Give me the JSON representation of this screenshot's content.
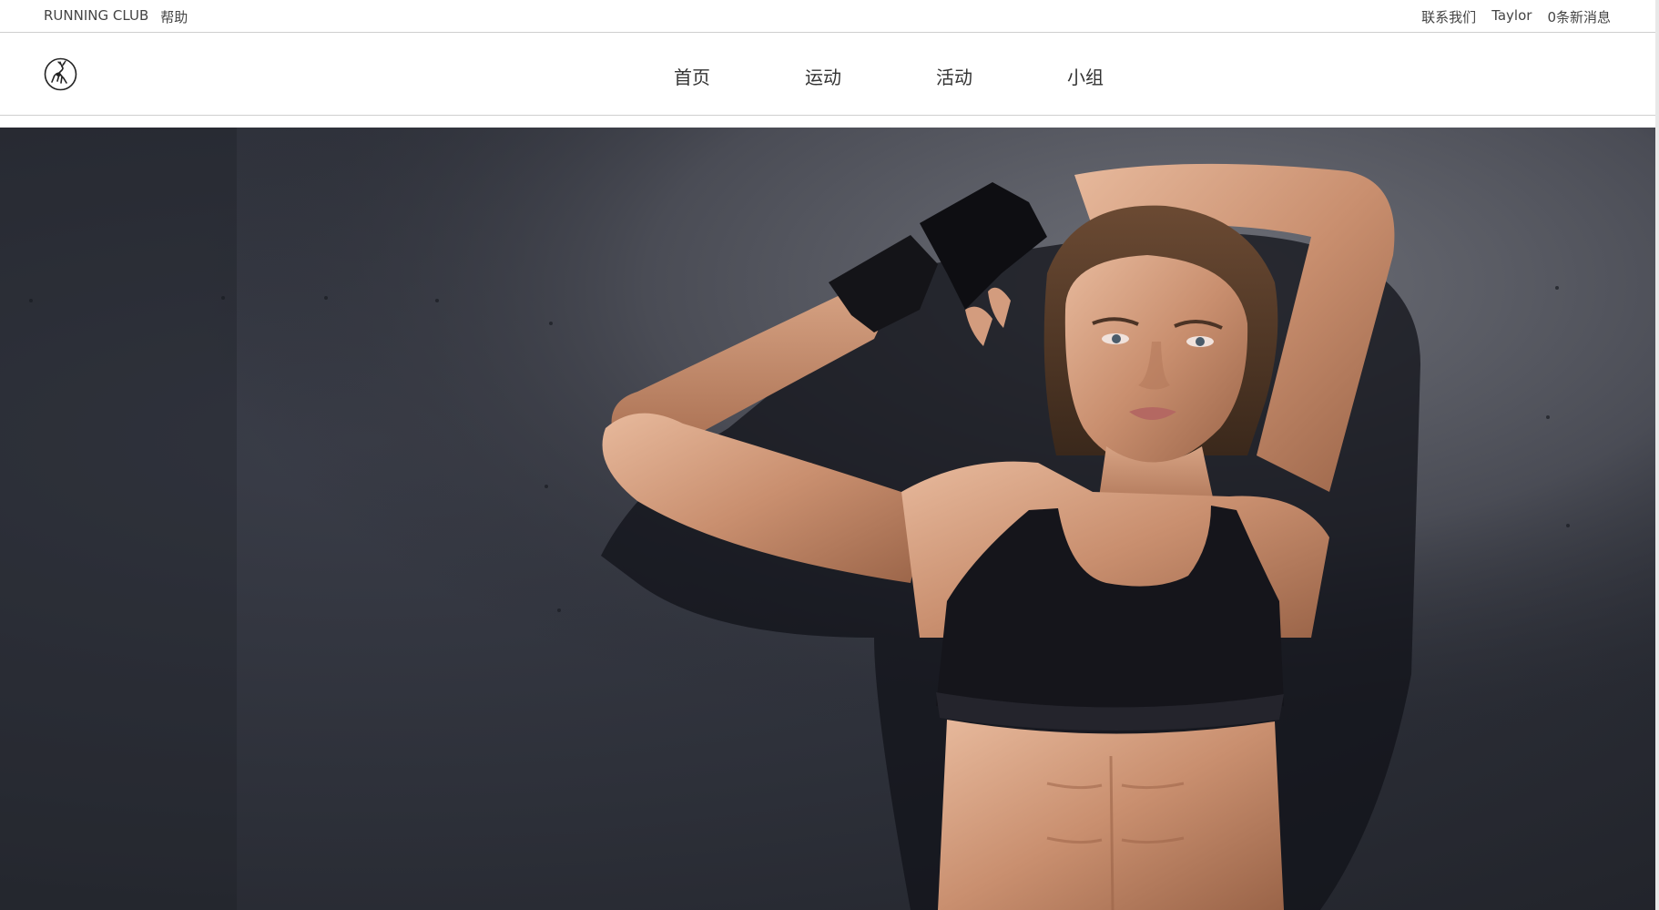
{
  "topbar": {
    "brand": "RUNNING CLUB",
    "help": "帮助",
    "contact": "联系我们",
    "user": "Taylor",
    "messages": "0条新消息"
  },
  "header": {
    "logo_icon": "deer-emblem-icon"
  },
  "nav": {
    "items": [
      {
        "label": "首页"
      },
      {
        "label": "运动"
      },
      {
        "label": "活动"
      },
      {
        "label": "小组"
      }
    ]
  },
  "hero": {
    "image": "fitness-woman-photo"
  },
  "colors": {
    "text": "#444444",
    "nav_text": "#333333",
    "divider": "#cfcfcf",
    "hero_bg": "#2d3039"
  }
}
